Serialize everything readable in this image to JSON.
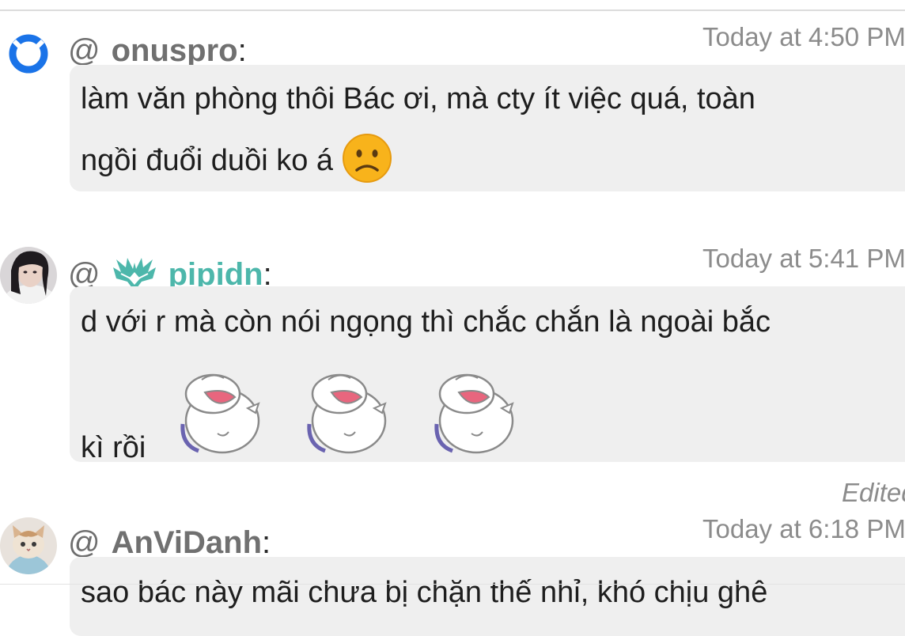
{
  "messages": [
    {
      "username": "onuspro",
      "at": "@",
      "colon": ":",
      "timestamp": "Today at 4:50 PM",
      "avatar_icon": "onus-ring-logo",
      "text_line1": "làm văn phòng thôi Bác ơi, mà cty ít việc quá, toàn",
      "text_line2": "ngồi đuổi duồi ko á",
      "emoji": "slightly-frowning-face"
    },
    {
      "username": "pipidn",
      "at": "@",
      "colon": ":",
      "timestamp": "Today at 5:41 PM",
      "avatar_icon": "user-photo",
      "badge_icon": "winged-emblem-icon",
      "text_line1": "d với r mà còn nói ngọng thì chắc chắn là ngoài bắc",
      "text_line2": "kì rồi",
      "stickers": [
        "laughing-rolling-bun-sticker",
        "laughing-rolling-bun-sticker",
        "laughing-rolling-bun-sticker"
      ]
    },
    {
      "edited_label": "Edited",
      "username": "AnViDanh",
      "at": "@",
      "colon": ":",
      "timestamp": "Today at 6:18 PM",
      "avatar_icon": "cat-photo",
      "text_line1": "sao bác này mãi chưa bị chặn thế nhỉ, khó chịu ghê"
    }
  ],
  "colors": {
    "bubble": "#efefef",
    "username": "#707070",
    "username_teal": "#4db7ab",
    "timestamp": "#8c8c8c",
    "onus_blue": "#1a73e8"
  }
}
